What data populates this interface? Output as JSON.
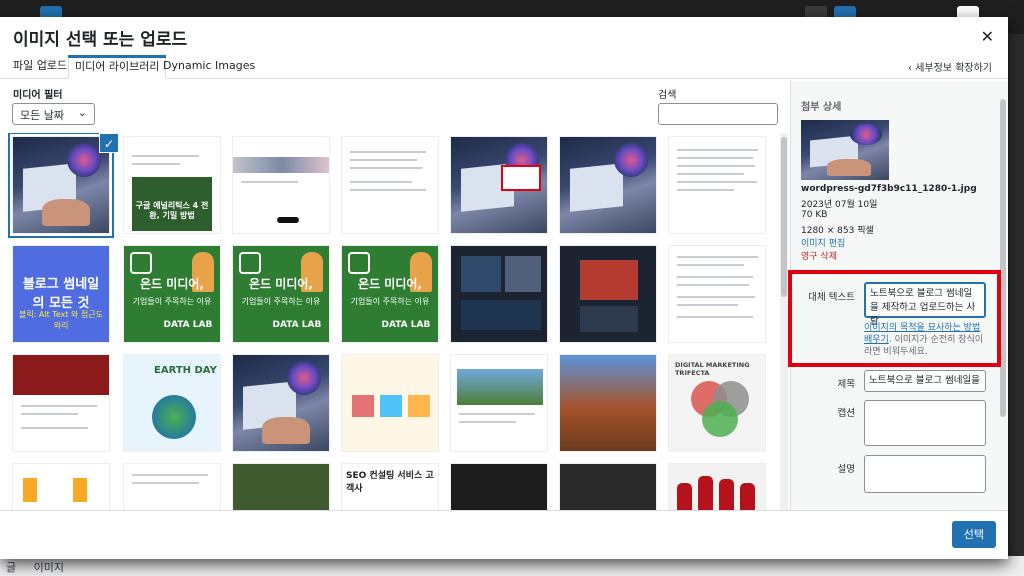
{
  "modal": {
    "title": "이미지 선택 또는 업로드",
    "close_icon": "close-icon"
  },
  "tabs": [
    {
      "label": "파일 업로드"
    },
    {
      "label": "미디어 라이브러리"
    },
    {
      "label": "Dynamic Images"
    }
  ],
  "expand_details": "‹ 세부정보 확장하기",
  "filter": {
    "label": "미디어 필터",
    "date_value": "모든 날짜"
  },
  "search": {
    "label": "검색",
    "value": ""
  },
  "sidebar": {
    "heading": "첨부 상세",
    "filename": "wordpress-gd7f3b9c11_1280-1.jpg",
    "date": "2023년 07월 10일",
    "size": "70 KB",
    "dimensions": "1280 × 853 픽셀",
    "edit_link": "이미지 편집",
    "delete_link": "영구 삭제",
    "alt_label": "대체 텍스트",
    "alt_value": "노트북으로 블로그 썸네일을 제작하고 업로드하는 사람",
    "alt_help_link": "이미지의 목적을 묘사하는 방법 배우기",
    "alt_help_text": ". 이미지가 순전히 장식이라면 비워두세요.",
    "title_label": "제목",
    "title_value": "노트북으로 블로그 썸네일을",
    "caption_label": "캡션",
    "caption_value": "",
    "description_label": "설명",
    "description_value": ""
  },
  "footer": {
    "select_label": "선택"
  },
  "thumbs": {
    "green_text": "온드 미디어,",
    "green_sub": "기업들이 주목하는 이유",
    "green_logo": "DATA LAB",
    "blue_text": "블로그 썸네일의 모든 것",
    "blue_sub": "블릭: Alt Text 와 접근도와리",
    "analytics_text": "구글 애널리틱스 4 전환, 기밀 방법",
    "earth_text": "EARTH DAY",
    "seo_text": "SEO 컨설팅 서비스 고객사",
    "trifecta_text": "DIGITAL MARKETING TRIFECTA"
  },
  "colors": {
    "accent": "#2271b1",
    "highlight": "#e3000f",
    "danger": "#b32d2e"
  },
  "background": {
    "bottom_items": [
      "글",
      "이미지"
    ]
  }
}
